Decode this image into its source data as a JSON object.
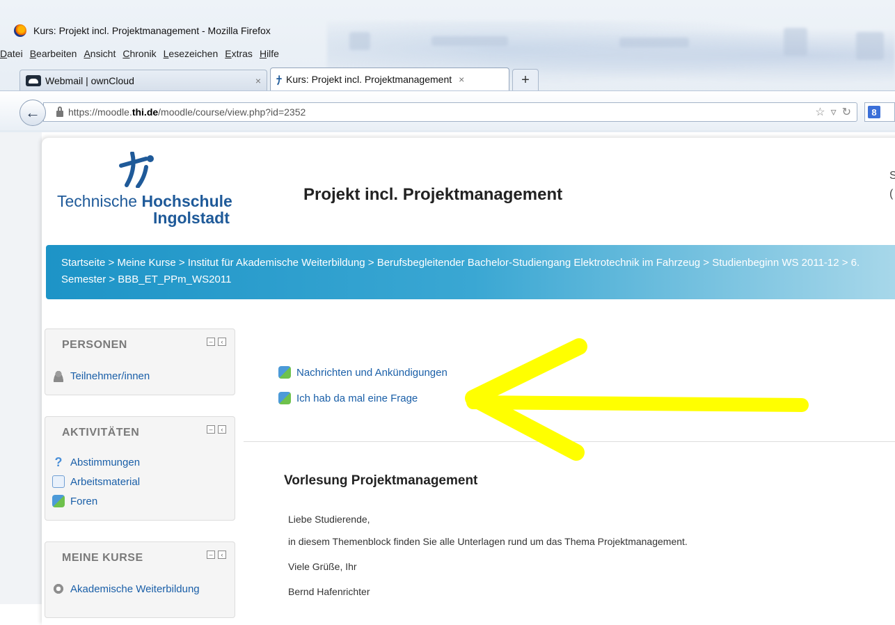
{
  "browser": {
    "window_title": "Kurs: Projekt incl. Projektmanagement - Mozilla Firefox",
    "menu": [
      {
        "underlined": "D",
        "rest": "atei"
      },
      {
        "underlined": "B",
        "rest": "earbeiten"
      },
      {
        "underlined": "A",
        "rest": "nsicht"
      },
      {
        "underlined": "C",
        "rest": "hronik"
      },
      {
        "underlined": "L",
        "rest": "esezeichen"
      },
      {
        "underlined": "E",
        "rest": "xtras",
        "prefix": ""
      },
      {
        "underlined": "H",
        "rest": "ilfe"
      }
    ],
    "tabs": [
      {
        "label": "Webmail | ownCloud",
        "close": "×"
      },
      {
        "label": "Kurs: Projekt incl. Projektmanagement",
        "close": "×"
      }
    ],
    "new_tab": "+",
    "url": {
      "prefix": "https://moodle.",
      "host": "thi.de",
      "path": "/moodle/course/view.php?id=2352"
    },
    "search_engine_badge": "8"
  },
  "page": {
    "logo": {
      "line1_regular": "Technische ",
      "line1_bold": "Hochschule",
      "line2": "Ingolstadt"
    },
    "course_title": "Projekt incl. Projektmanagement",
    "corner_fragment": [
      "S",
      "("
    ],
    "breadcrumb": "Startseite > Meine Kurse > Institut für Akademische Weiterbildung > Berufsbegleitender Bachelor-Studiengang Elektrotechnik im Fahrzeug > Studienbeginn WS 2011-12 > 6. Semester > BBB_ET_PPm_WS2011",
    "blocks": {
      "personen": {
        "title": "PERSONEN",
        "items": [
          {
            "label": "Teilnehmer/innen",
            "icon": "people-icon"
          }
        ]
      },
      "aktivitaeten": {
        "title": "AKTIVITÄTEN",
        "items": [
          {
            "label": "Abstimmungen",
            "icon": "question-icon"
          },
          {
            "label": "Arbeitsmaterial",
            "icon": "document-icon"
          },
          {
            "label": "Foren",
            "icon": "forum-icon"
          }
        ]
      },
      "meine_kurse": {
        "title": "MEINE KURSE",
        "items": [
          {
            "label": "Akademische Weiterbildung",
            "icon": "courses-icon"
          }
        ]
      }
    },
    "forums": [
      {
        "label": "Nachrichten und Ankündigungen"
      },
      {
        "label": "Ich hab da mal eine Frage"
      }
    ],
    "section": {
      "title": "Vorlesung Projektmanagement",
      "lines": [
        "Liebe Studierende,",
        "in diesem Themenblock finden Sie alle Unterlagen rund um das Thema Projektmanagement.",
        "Viele Grüße, Ihr",
        "Bernd Hafenrichter"
      ]
    },
    "colors": {
      "link": "#1a5fa8",
      "breadcrumb_start": "#1d94c7",
      "annotation_arrow": "#ffff00"
    }
  }
}
